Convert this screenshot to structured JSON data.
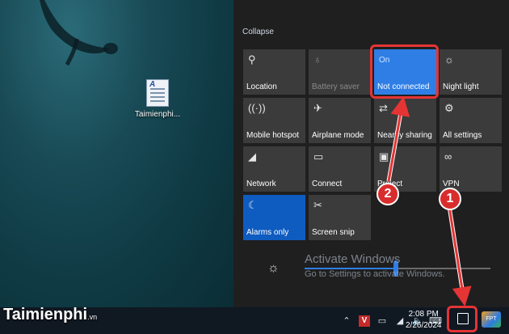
{
  "desktop": {
    "icon_label": "Taimienphi...",
    "icon_glyph": "A"
  },
  "action_center": {
    "collapse_label": "Collapse",
    "tiles": [
      {
        "label": "Location",
        "icon": "location-icon"
      },
      {
        "label": "Battery saver",
        "icon": "battery-saver-icon"
      },
      {
        "label": "Not connected",
        "status": "On",
        "icon": "wifi-icon"
      },
      {
        "label": "Night light",
        "icon": "night-light-icon"
      },
      {
        "label": "Mobile hotspot",
        "icon": "hotspot-icon"
      },
      {
        "label": "Airplane mode",
        "icon": "airplane-icon"
      },
      {
        "label": "Nearby sharing",
        "icon": "nearby-sharing-icon"
      },
      {
        "label": "All settings",
        "icon": "settings-icon"
      },
      {
        "label": "Network",
        "icon": "network-icon"
      },
      {
        "label": "Connect",
        "icon": "connect-icon"
      },
      {
        "label": "Project",
        "icon": "project-icon"
      },
      {
        "label": "VPN",
        "icon": "vpn-icon"
      },
      {
        "label": "Alarms only",
        "icon": "moon-icon"
      },
      {
        "label": "Screen snip",
        "icon": "screen-snip-icon"
      }
    ],
    "watermark_title": "Activate Windows",
    "watermark_sub": "Go to Settings to activate Windows."
  },
  "taskbar": {
    "time": "2:08 PM",
    "date": "2/26/2024",
    "v_icon_text": "V"
  },
  "branding": {
    "logo_text": "Taimienphi",
    "logo_sub": ".vn",
    "fpt_text": "FPT"
  },
  "annotations": {
    "badge1": "1",
    "badge2": "2",
    "color": "#e53434"
  },
  "colors": {
    "accent": "#2e7ee6",
    "tile": "#3b3b3b",
    "panel": "#1f1f1f"
  }
}
